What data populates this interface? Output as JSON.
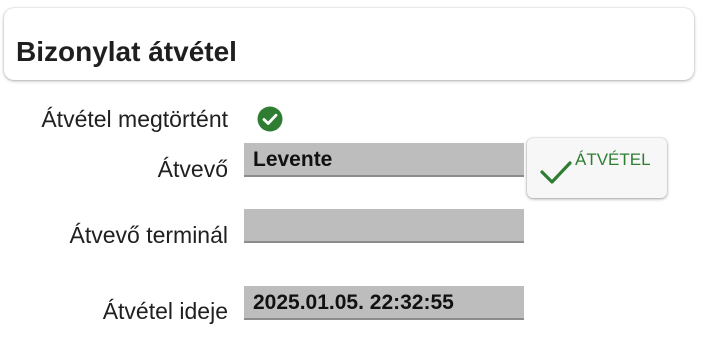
{
  "header": {
    "title": "Bizonylat átvétel"
  },
  "form": {
    "status_label": "Átvétel megtörtént",
    "status_icon": "check-circle-icon",
    "receiver_label": "Átvevő",
    "receiver_value": "Levente",
    "terminal_label": "Átvevő terminál",
    "terminal_value": "",
    "time_label": "Átvétel ideje",
    "time_value": "2025.01.05. 22:32:55"
  },
  "action": {
    "label": "ÁTVÉTEL",
    "icon": "checkmark-icon"
  },
  "colors": {
    "accent_green": "#2e7d32",
    "field_bg": "#bdbdbd"
  }
}
